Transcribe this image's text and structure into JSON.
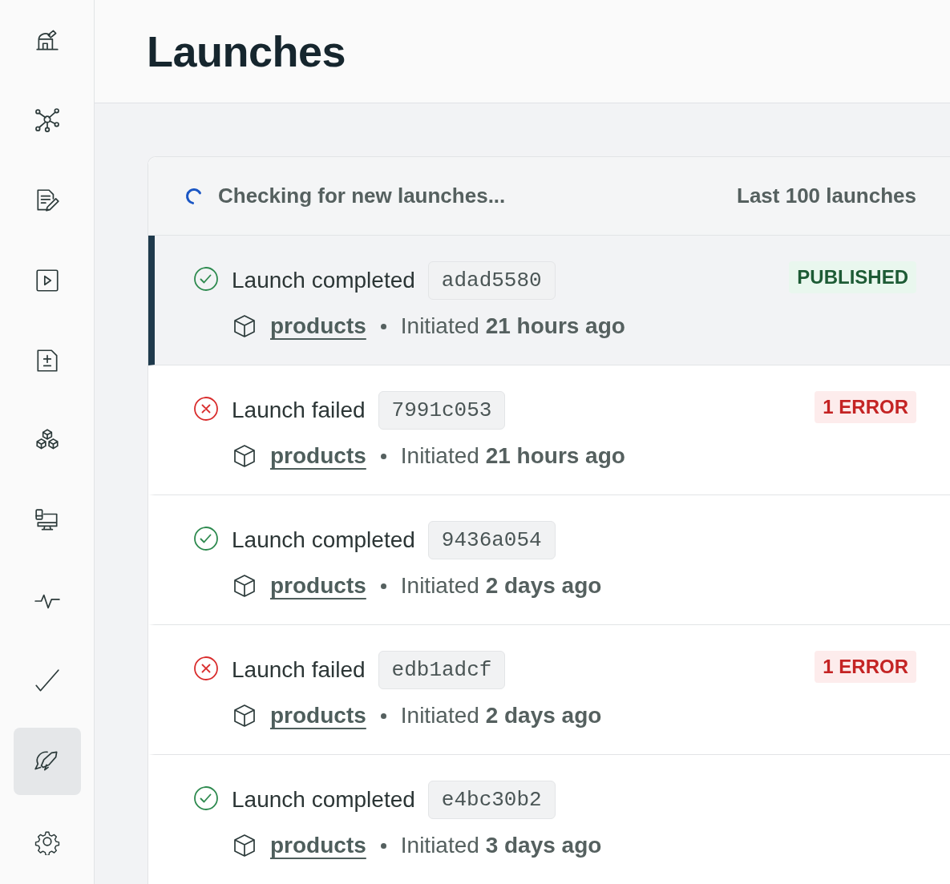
{
  "sidebar": {
    "items": [
      {
        "kind": "observatory",
        "selected": false
      },
      {
        "kind": "graph",
        "selected": false
      },
      {
        "kind": "notes",
        "selected": false
      },
      {
        "kind": "play",
        "selected": false
      },
      {
        "kind": "diff",
        "selected": false
      },
      {
        "kind": "assets",
        "selected": false
      },
      {
        "kind": "devices",
        "selected": false
      },
      {
        "kind": "pulse",
        "selected": false
      },
      {
        "kind": "check",
        "selected": false
      },
      {
        "kind": "launches",
        "selected": true
      },
      {
        "kind": "settings",
        "selected": false
      }
    ]
  },
  "page": {
    "title": "Launches"
  },
  "list": {
    "status": "Checking for new launches...",
    "count": "Last 100 launches",
    "rows": [
      {
        "kind": "completed",
        "title": "Launch completed",
        "commit": "adad5580",
        "project": "products",
        "initiated": "Initiated **21 hours ago**",
        "badge": {
          "kind": "published",
          "text": "PUBLISHED"
        },
        "selected": true
      },
      {
        "kind": "failed",
        "title": "Launch failed",
        "commit": "7991c053",
        "project": "products",
        "initiated": "Initiated **21 hours ago**",
        "badge": {
          "kind": "error",
          "text": "1 ERROR"
        },
        "selected": false
      },
      {
        "kind": "completed",
        "title": "Launch completed",
        "commit": "9436a054",
        "project": "products",
        "initiated": "Initiated **2 days ago**",
        "selected": false
      },
      {
        "kind": "failed",
        "title": "Launch failed",
        "commit": "edb1adcf",
        "project": "products",
        "initiated": "Initiated **2 days ago**",
        "badge": {
          "kind": "error",
          "text": "1 ERROR"
        },
        "selected": false
      },
      {
        "kind": "completed",
        "title": "Launch completed",
        "commit": "e4bc30b2",
        "project": "products",
        "initiated": "Initiated **3 days ago**",
        "selected": false
      }
    ]
  }
}
